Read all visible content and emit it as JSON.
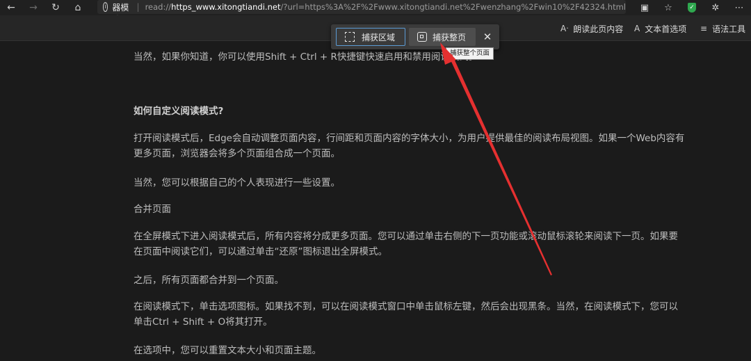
{
  "browser": {
    "mode_label": "阅读器模式",
    "url_separator": "|",
    "url_prefix": "read://",
    "url_host": "https_www.xitongtiandi.net",
    "url_rest": "/?url=https%3A%2F%2Fwww.xitongtiandi.net%2Fwenzhang%2Fwin10%2F42324.html"
  },
  "reader_toolbar": {
    "read_aloud": "朗读此页内容",
    "text_prefs": "文本首选项",
    "grammar_tools": "语法工具"
  },
  "capture_popup": {
    "region_label": "捕获区域",
    "full_label": "捕获整页",
    "tooltip": "捕获整个页面"
  },
  "article": {
    "paragraphs": [
      "当然，如果你知道，你可以使用Shift + Ctrl + R快捷键快速启用和禁用阅读模式。",
      "如何自定义阅读模式?",
      "打开阅读模式后，Edge会自动调整页面内容，行间距和页面内容的字体大小，为用户提供最佳的阅读布局视图。如果一个Web内容有更多页面，浏览器会将多个页面组合成一个页面。",
      "当然，您可以根据自己的个人表现进行一些设置。",
      "合并页面",
      "在全屏模式下进入阅读模式后，所有内容将分成更多页面。您可以通过单击右侧的下一页功能或滚动鼠标滚轮来阅读下一页。如果要在页面中阅读它们，可以通过单击“还原”图标退出全屏模式。",
      "之后，所有页面都合并到一个页面。",
      "在阅读模式下，单击选项图标。如果找不到，可以在阅读模式窗口中单击鼠标左键，然后会出现黑条。当然，在阅读模式下，您可以单击Ctrl + Shift + O将其打开。",
      "在选项中，您可以重置文本大小和页面主题。"
    ]
  },
  "colors": {
    "annotation_arrow": "#e53030",
    "accent": "#5b9bd5"
  },
  "icons": [
    "back-icon",
    "forward-icon",
    "refresh-icon",
    "home-icon",
    "info-icon",
    "immersive-reader-icon",
    "favorites-icon",
    "shield-extension-icon",
    "extensions-icon",
    "read-aloud-icon",
    "text-prefs-icon",
    "grammar-icon",
    "capture-region-icon",
    "capture-full-icon",
    "close-icon"
  ]
}
